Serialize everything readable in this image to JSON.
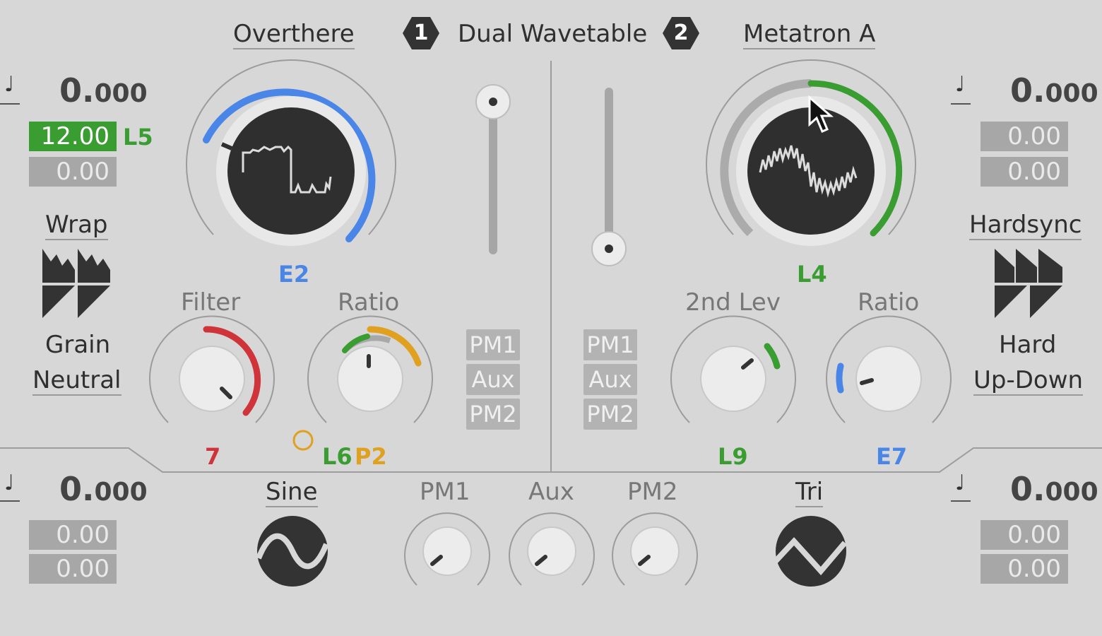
{
  "header": {
    "osc1_name": "Overthere",
    "osc1_badge": "1",
    "title": "Dual Wavetable",
    "osc2_badge": "2",
    "osc2_name": "Metatron A"
  },
  "left": {
    "note_icon": "♩",
    "offset_int": "0.",
    "offset_dec": "000",
    "value1": "12.00",
    "value1_mod": "L5",
    "value2": "0.00",
    "sync_mode_label": "Wrap",
    "grain_label": "Grain",
    "neutral_label": "Neutral",
    "bottom_offset_int": "0.",
    "bottom_offset_dec": "000",
    "bottom_value1": "0.00",
    "bottom_value2": "0.00"
  },
  "right": {
    "note_icon": "♩",
    "offset_int": "0.",
    "offset_dec": "000",
    "value1": "0.00",
    "value2": "0.00",
    "sync_mode_label": "Hardsync",
    "hard_label": "Hard",
    "updown_label": "Up-Down",
    "bottom_offset_int": "0.",
    "bottom_offset_dec": "000",
    "bottom_value1": "0.00",
    "bottom_value2": "0.00"
  },
  "osc1": {
    "wave_knob_mod": "E2",
    "filter_label": "Filter",
    "filter_mod": "7",
    "ratio_label": "Ratio",
    "ratio_mod1": "L6",
    "ratio_mod2": "P2",
    "routing": [
      "PM1",
      "Aux",
      "PM2"
    ],
    "accent": "#4a86e8"
  },
  "osc2": {
    "wave_knob_mod": "L4",
    "lev_label": "2nd Lev",
    "lev_mod": "L9",
    "ratio_label": "Ratio",
    "ratio_mod": "E7",
    "routing": [
      "PM1",
      "Aux",
      "PM2"
    ],
    "accent": "#3a9d32"
  },
  "bottom": {
    "wave1_label": "Sine",
    "pm1_label": "PM1",
    "aux_label": "Aux",
    "pm2_label": "PM2",
    "wave2_label": "Tri"
  },
  "colors": {
    "blue": "#4a86e8",
    "green": "#3a9d32",
    "red": "#d0343b",
    "orange": "#e0a020"
  }
}
